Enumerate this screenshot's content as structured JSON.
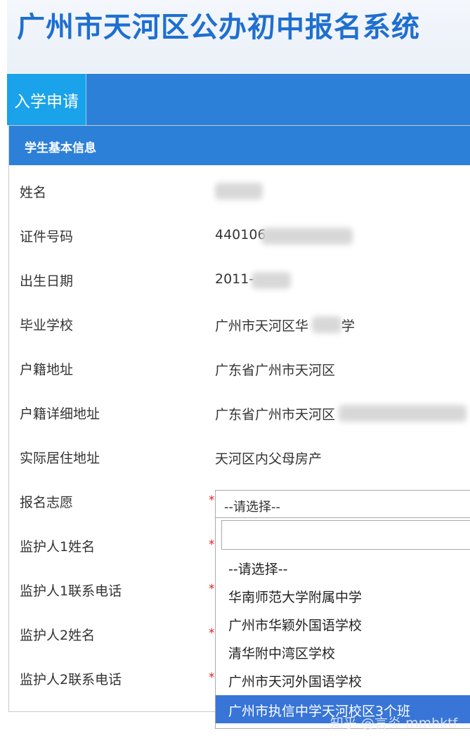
{
  "header": {
    "title": "广州市天河区公办初中报名系统"
  },
  "nav": {
    "tab_apply": "入学申请"
  },
  "section": {
    "title": "学生基本信息"
  },
  "fields": [
    {
      "label": "姓名",
      "value": ""
    },
    {
      "label": "证件号码",
      "value": "440106"
    },
    {
      "label": "出生日期",
      "value": "2011-"
    },
    {
      "label": "毕业学校",
      "value": "广州市天河区华",
      "suffix": "学"
    },
    {
      "label": "户籍地址",
      "value": "广东省广州市天河区"
    },
    {
      "label": "户籍详细地址",
      "value": "广东省广州市天河区"
    },
    {
      "label": "实际居住地址",
      "value": "天河区内父母房产"
    },
    {
      "label": "报名志愿",
      "value": ""
    },
    {
      "label": "监护人1姓名",
      "value": ""
    },
    {
      "label": "监护人1联系电话",
      "value": ""
    },
    {
      "label": "监护人2姓名",
      "value": ""
    },
    {
      "label": "监护人2联系电话",
      "value": ""
    }
  ],
  "required_mark": "*",
  "select": {
    "current": "--请选择--",
    "search_value": "",
    "options": [
      "--请选择--",
      "华南师范大学附属中学",
      "广州市华颖外国语学校",
      "清华附中湾区学校",
      "广州市天河外国语学校",
      "广州市执信中学天河校区3个班"
    ],
    "highlighted_index": 5
  },
  "watermark": "知乎 @言炎 mmhktf"
}
